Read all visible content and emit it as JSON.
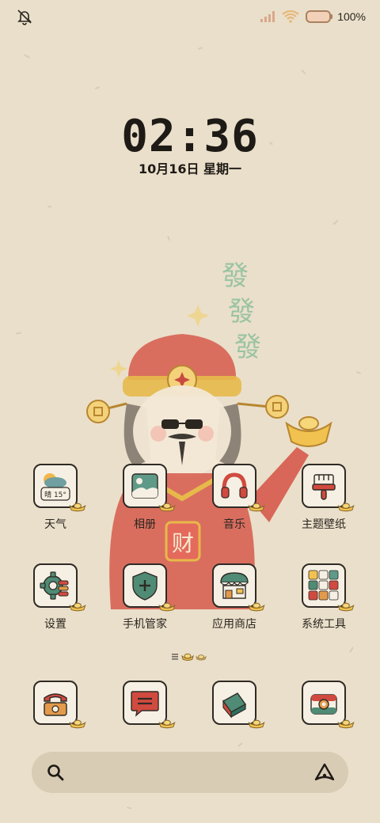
{
  "status_bar": {
    "battery_text": "100%",
    "battery_level": 1.0,
    "left_icon": "bell-off-icon",
    "right_icons": [
      "signal-icon",
      "wifi-icon",
      "battery-icon"
    ]
  },
  "lock": {
    "time": "02:36",
    "date": "10月16日 星期一"
  },
  "apps": [
    {
      "name": "app-weather",
      "label": "天气",
      "icon": "weather-icon",
      "badge": "晴 15°"
    },
    {
      "name": "app-gallery",
      "label": "相册",
      "icon": "gallery-icon"
    },
    {
      "name": "app-music",
      "label": "音乐",
      "icon": "headphones-icon"
    },
    {
      "name": "app-themes",
      "label": "主题壁纸",
      "icon": "paintbrush-icon"
    },
    {
      "name": "app-settings",
      "label": "设置",
      "icon": "gear-icon"
    },
    {
      "name": "app-phone-manager",
      "label": "手机管家",
      "icon": "shield-icon"
    },
    {
      "name": "app-store",
      "label": "应用商店",
      "icon": "store-icon"
    },
    {
      "name": "app-system-tools",
      "label": "系统工具",
      "icon": "folder-grid-icon"
    }
  ],
  "dock": [
    {
      "name": "dock-phone",
      "icon": "telephone-icon"
    },
    {
      "name": "dock-messages",
      "icon": "message-icon"
    },
    {
      "name": "dock-browser",
      "icon": "browser-icon"
    },
    {
      "name": "dock-camera",
      "icon": "camera-icon"
    }
  ],
  "page_indicator": {
    "pages": 2,
    "current": 1
  },
  "wallpaper": {
    "art_text": "發 發 發",
    "belly_text": "财"
  },
  "colors": {
    "background": "#eadfca",
    "accent_red": "#c94a3f",
    "gold": "#e7b94a",
    "outline": "#2f2a25",
    "teal": "#4f8b75"
  }
}
